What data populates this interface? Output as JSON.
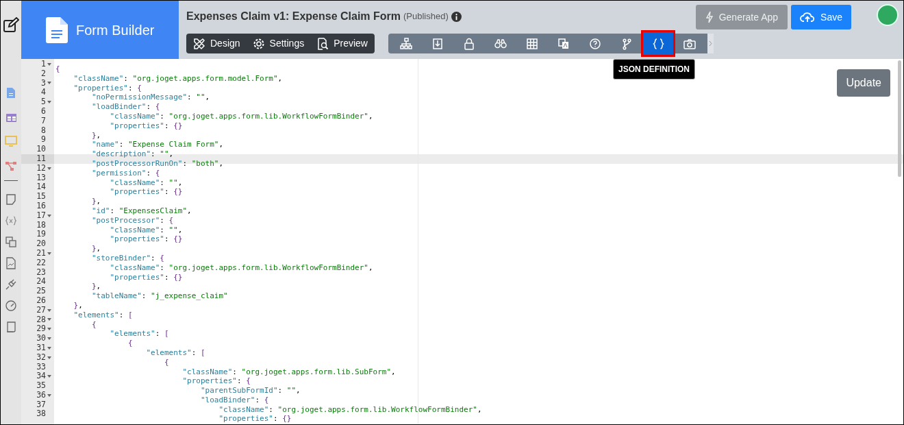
{
  "header": {
    "logo_text": "Form Builder",
    "title": "Expenses Claim v1: Expense Claim Form",
    "status": "(Published)"
  },
  "modes": [
    {
      "label": "Design",
      "selected": false
    },
    {
      "label": "Settings",
      "selected": false
    },
    {
      "label": "Preview",
      "selected": false
    }
  ],
  "tools": [
    {
      "selected": false
    },
    {
      "selected": false
    },
    {
      "selected": false
    },
    {
      "selected": false
    },
    {
      "selected": false
    },
    {
      "selected": false
    },
    {
      "selected": false
    },
    {
      "selected": false
    },
    {
      "selected": true
    },
    {
      "selected": false
    }
  ],
  "tooltip": "JSON DEFINITION",
  "actions": [
    {
      "label": "Generate App",
      "kind": "secondary"
    },
    {
      "label": "Save",
      "kind": "primary"
    }
  ],
  "update_button": "Update",
  "editor": {
    "lines": [
      {
        "number": "1",
        "text": "{",
        "foldable": true,
        "current": false
      },
      {
        "number": "2",
        "text": "    \"className\": \"org.joget.apps.form.model.Form\",",
        "foldable": false,
        "current": false
      },
      {
        "number": "3",
        "text": "    \"properties\": {",
        "foldable": true,
        "current": false
      },
      {
        "number": "4",
        "text": "        \"noPermissionMessage\": \"\",",
        "foldable": false,
        "current": false
      },
      {
        "number": "5",
        "text": "        \"loadBinder\": {",
        "foldable": true,
        "current": false
      },
      {
        "number": "6",
        "text": "            \"className\": \"org.joget.apps.form.lib.WorkflowFormBinder\",",
        "foldable": false,
        "current": false
      },
      {
        "number": "7",
        "text": "            \"properties\": {}",
        "foldable": false,
        "current": false
      },
      {
        "number": "8",
        "text": "        },",
        "foldable": false,
        "current": false
      },
      {
        "number": "9",
        "text": "        \"name\": \"Expense Claim Form\",",
        "foldable": false,
        "current": false
      },
      {
        "number": "10",
        "text": "        \"description\": \"\",",
        "foldable": false,
        "current": false
      },
      {
        "number": "11",
        "text": "        \"postProcessorRunOn\": \"both\",",
        "foldable": false,
        "current": true
      },
      {
        "number": "12",
        "text": "        \"permission\": {",
        "foldable": true,
        "current": false
      },
      {
        "number": "13",
        "text": "            \"className\": \"\",",
        "foldable": false,
        "current": false
      },
      {
        "number": "14",
        "text": "            \"properties\": {}",
        "foldable": false,
        "current": false
      },
      {
        "number": "15",
        "text": "        },",
        "foldable": false,
        "current": false
      },
      {
        "number": "16",
        "text": "        \"id\": \"ExpensesClaim\",",
        "foldable": false,
        "current": false
      },
      {
        "number": "17",
        "text": "        \"postProcessor\": {",
        "foldable": true,
        "current": false
      },
      {
        "number": "18",
        "text": "            \"className\": \"\",",
        "foldable": false,
        "current": false
      },
      {
        "number": "19",
        "text": "            \"properties\": {}",
        "foldable": false,
        "current": false
      },
      {
        "number": "20",
        "text": "        },",
        "foldable": false,
        "current": false
      },
      {
        "number": "21",
        "text": "        \"storeBinder\": {",
        "foldable": true,
        "current": false
      },
      {
        "number": "22",
        "text": "            \"className\": \"org.joget.apps.form.lib.WorkflowFormBinder\",",
        "foldable": false,
        "current": false
      },
      {
        "number": "23",
        "text": "            \"properties\": {}",
        "foldable": false,
        "current": false
      },
      {
        "number": "24",
        "text": "        },",
        "foldable": false,
        "current": false
      },
      {
        "number": "25",
        "text": "        \"tableName\": \"j_expense_claim\"",
        "foldable": false,
        "current": false
      },
      {
        "number": "26",
        "text": "    },",
        "foldable": false,
        "current": false
      },
      {
        "number": "27",
        "text": "    \"elements\": [",
        "foldable": true,
        "current": false
      },
      {
        "number": "28",
        "text": "        {",
        "foldable": true,
        "current": false
      },
      {
        "number": "29",
        "text": "            \"elements\": [",
        "foldable": true,
        "current": false
      },
      {
        "number": "30",
        "text": "                {",
        "foldable": true,
        "current": false
      },
      {
        "number": "31",
        "text": "                    \"elements\": [",
        "foldable": true,
        "current": false
      },
      {
        "number": "32",
        "text": "                        {",
        "foldable": true,
        "current": false
      },
      {
        "number": "33",
        "text": "                            \"className\": \"org.joget.apps.form.lib.SubForm\",",
        "foldable": false,
        "current": false
      },
      {
        "number": "34",
        "text": "                            \"properties\": {",
        "foldable": true,
        "current": false
      },
      {
        "number": "35",
        "text": "                                \"parentSubFormId\": \"\",",
        "foldable": false,
        "current": false
      },
      {
        "number": "36",
        "text": "                                \"loadBinder\": {",
        "foldable": true,
        "current": false
      },
      {
        "number": "37",
        "text": "                                    \"className\": \"org.joget.apps.form.lib.WorkflowFormBinder\",",
        "foldable": false,
        "current": false
      },
      {
        "number": "38",
        "text": "                                    \"properties\": {}",
        "foldable": false,
        "current": false
      }
    ]
  }
}
